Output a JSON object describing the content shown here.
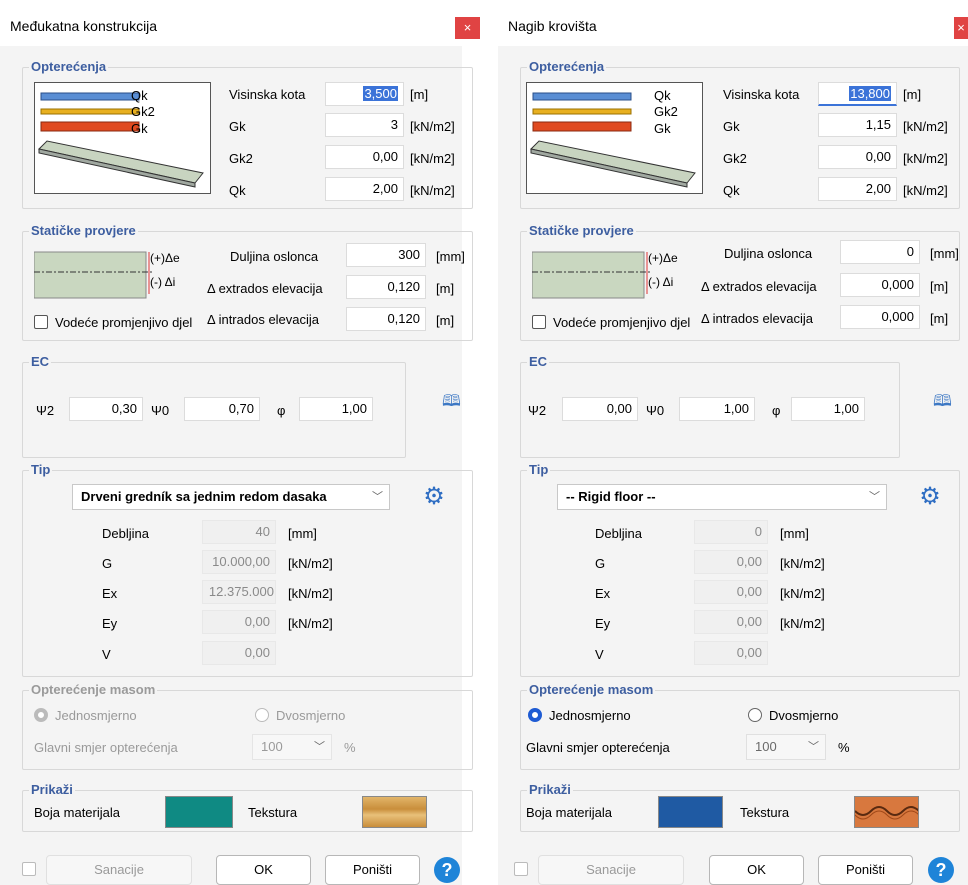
{
  "d1": {
    "title": "Međukatna konstrukcija",
    "close": "×",
    "opt": {
      "header": "Opterećenja",
      "legend_qk": "Qk",
      "legend_gk2": "Gk2",
      "legend_gk": "Gk",
      "visinska_label": "Visinska kota",
      "visinska_value": "3,500",
      "visinska_unit": "[m]",
      "gk_label": "Gk",
      "gk_value": "3",
      "gk_unit": "[kN/m2]",
      "gk2_label": "Gk2",
      "gk2_value": "0,00",
      "gk2_unit": "[kN/m2]",
      "qk_label": "Qk",
      "qk_value": "2,00",
      "qk_unit": "[kN/m2]"
    },
    "stat": {
      "header": "Statičke provjere",
      "plus": "(+)Δe",
      "minus": "(-) Δi",
      "duljina_label": "Duljina oslonca",
      "duljina_value": "300",
      "duljina_unit": "[mm]",
      "extrados_label": "Δ extrados elevacija",
      "extrados_value": "0,120",
      "extrados_unit": "[m]",
      "intrados_label": "Δ intrados elevacija",
      "intrados_value": "0,120",
      "intrados_unit": "[m]",
      "vodece": "Vodeće promjenjivo djel"
    },
    "ec": {
      "header": "EC",
      "psi2_label": "Ψ2",
      "psi2_value": "0,30",
      "psi0_label": "Ψ0",
      "psi0_value": "0,70",
      "phi_label": "φ",
      "phi_value": "1,00"
    },
    "tip": {
      "header": "Tip",
      "combo": "Drveni gredník sa jednim redom dasaka",
      "debljina_label": "Debljina",
      "debljina_value": "40",
      "debljina_unit": "[mm]",
      "g_label": "G",
      "g_value": "10.000,00",
      "g_unit": "[kN/m2]",
      "ex_label": "Ex",
      "ex_value": "12.375.000",
      "ex_unit": "[kN/m2]",
      "ey_label": "Ey",
      "ey_value": "0,00",
      "ey_unit": "[kN/m2]",
      "v_label": "V",
      "v_value": "0,00"
    },
    "mass": {
      "header": "Opterećenje masom",
      "jedno": "Jednosmjerno",
      "dvo": "Dvosmjerno",
      "glavni": "Glavni smjer opterećenja",
      "pct_value": "100",
      "pct_unit": "%"
    },
    "prikazi": {
      "header": "Prikaži",
      "boja": "Boja materijala",
      "tekstura": "Tekstura",
      "color": "#0f8a83"
    },
    "buttons": {
      "sanacije": "Sanacije",
      "ok": "OK",
      "ponisti": "Poništi",
      "help": "?"
    }
  },
  "d2": {
    "title": "Nagib krovišta",
    "close": "×",
    "opt": {
      "header": "Opterećenja",
      "legend_qk": "Qk",
      "legend_gk2": "Gk2",
      "legend_gk": "Gk",
      "visinska_label": "Visinska kota",
      "visinska_value": "13,800",
      "visinska_unit": "[m]",
      "gk_label": "Gk",
      "gk_value": "1,15",
      "gk_unit": "[kN/m2]",
      "gk2_label": "Gk2",
      "gk2_value": "0,00",
      "gk2_unit": "[kN/m2]",
      "qk_label": "Qk",
      "qk_value": "2,00",
      "qk_unit": "[kN/m2]"
    },
    "stat": {
      "header": "Statičke provjere",
      "plus": "(+)Δe",
      "minus": "(-) Δi",
      "duljina_label": "Duljina oslonca",
      "duljina_value": "0",
      "duljina_unit": "[mm]",
      "extrados_label": "Δ extrados elevacija",
      "extrados_value": "0,000",
      "extrados_unit": "[m]",
      "intrados_label": "Δ intrados elevacija",
      "intrados_value": "0,000",
      "intrados_unit": "[m]",
      "vodece": "Vodeće promjenjivo djel"
    },
    "ec": {
      "header": "EC",
      "psi2_label": "Ψ2",
      "psi2_value": "0,00",
      "psi0_label": "Ψ0",
      "psi0_value": "1,00",
      "phi_label": "φ",
      "phi_value": "1,00"
    },
    "tip": {
      "header": "Tip",
      "combo": "-- Rigid floor --",
      "debljina_label": "Debljina",
      "debljina_value": "0",
      "debljina_unit": "[mm]",
      "g_label": "G",
      "g_value": "0,00",
      "g_unit": "[kN/m2]",
      "ex_label": "Ex",
      "ex_value": "0,00",
      "ex_unit": "[kN/m2]",
      "ey_label": "Ey",
      "ey_value": "0,00",
      "ey_unit": "[kN/m2]",
      "v_label": "V",
      "v_value": "0,00"
    },
    "mass": {
      "header": "Opterećenje masom",
      "jedno": "Jednosmjerno",
      "dvo": "Dvosmjerno",
      "glavni": "Glavni smjer opterećenja",
      "pct_value": "100",
      "pct_unit": "%"
    },
    "prikazi": {
      "header": "Prikaži",
      "boja": "Boja materijala",
      "tekstura": "Tekstura",
      "color": "#1f5aa3"
    },
    "buttons": {
      "sanacije": "Sanacije",
      "ok": "OK",
      "ponisti": "Poništi",
      "help": "?"
    }
  }
}
